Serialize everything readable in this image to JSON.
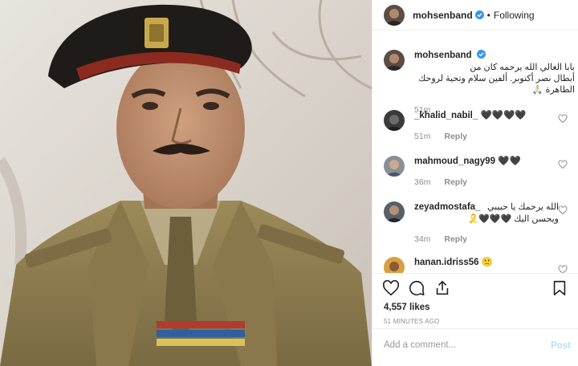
{
  "header": {
    "username": "mohsenband",
    "separator": "•",
    "follow_label": "Following"
  },
  "caption": {
    "username": "mohsenband",
    "text_line1": "بابا الغالي الله يرحمه كان من",
    "text_line2": "أبطال نصر أكتوبر. ألفين سلام وتحية لروحك",
    "text_line3": "الطاهرة 🙏🏻",
    "time": "51m"
  },
  "comments": [
    {
      "username": "_khalid_nabil_",
      "text": "🖤🖤🖤🖤",
      "time": "51m",
      "reply": "Reply"
    },
    {
      "username": "mahmoud_nagy99",
      "text": "🖤🖤",
      "time": "36m",
      "reply": "Reply"
    },
    {
      "username": "zeyadmostafa_",
      "text_line1": "الله يرحمك يا حبيبي",
      "text_line2": "ويحسن اليك 🖤🖤🖤🎗️",
      "time": "34m",
      "reply": "Reply"
    },
    {
      "username": "hanan.idriss56",
      "text": "🙁"
    }
  ],
  "likes": "4,557 likes",
  "posted_time": "51 MINUTES AGO",
  "add_comment": {
    "placeholder": "Add a comment...",
    "post_label": "Post"
  },
  "icons": {
    "verified": "verified-badge-icon",
    "like": "heart-icon",
    "comment": "comment-bubble-icon",
    "share": "share-icon",
    "save": "bookmark-icon"
  },
  "colors": {
    "verified_blue": "#3897f0",
    "post_button_disabled": "#b2dffc",
    "muted_text": "#8e8e8e"
  }
}
